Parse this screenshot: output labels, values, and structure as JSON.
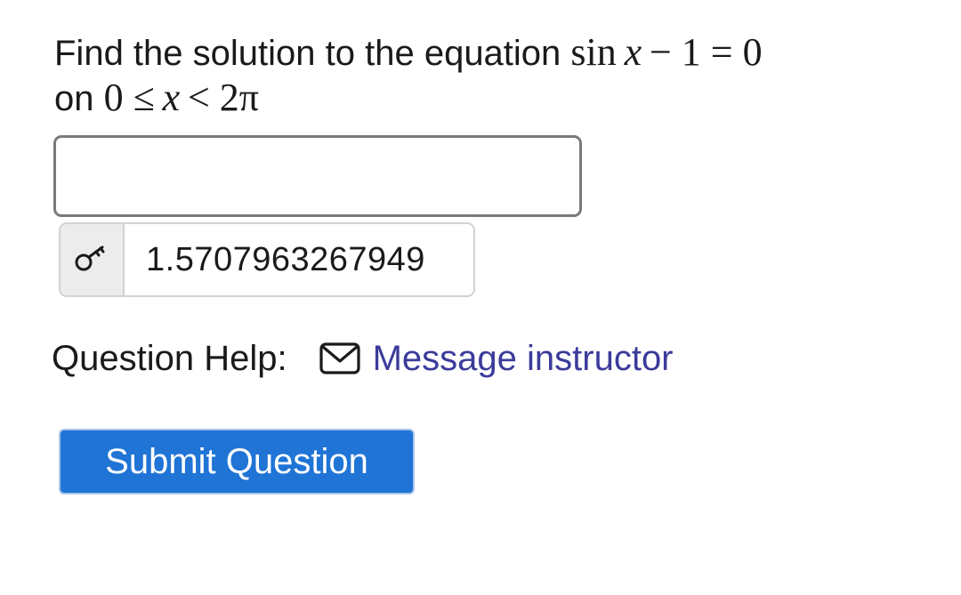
{
  "question": {
    "prefix": "Find the solution to the equation",
    "equation": {
      "func": "sin",
      "var": "x",
      "rest": "− 1 = 0"
    },
    "line2_prefix": "on",
    "interval": {
      "lower": "0 ≤",
      "var": "x",
      "upper": "< 2π"
    }
  },
  "answer_input": {
    "value": "",
    "placeholder": ""
  },
  "answer_key": {
    "icon": "key-icon",
    "value": "1.5707963267949"
  },
  "help": {
    "label": "Question Help:",
    "icon": "mail-icon",
    "link_text": "Message instructor"
  },
  "submit": {
    "label": "Submit Question"
  },
  "colors": {
    "link": "#3b3b9b",
    "submit_bg": "#1f74d6"
  }
}
